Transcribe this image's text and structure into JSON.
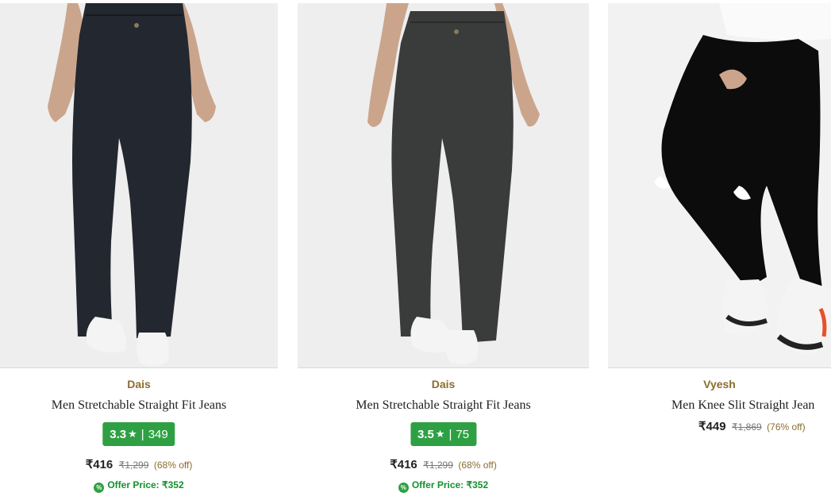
{
  "products": [
    {
      "brand": "Dais",
      "name": "Men Stretchable Straight Fit Jeans",
      "rating": "3.3",
      "star": "★",
      "separator": "|",
      "reviews": "349",
      "price": "₹416",
      "mrp": "₹1,299",
      "discount": "(68% off)",
      "offer": "Offer Price: ₹352",
      "offer_icon": "%",
      "jeans_color": "#23272f"
    },
    {
      "brand": "Dais",
      "name": "Men Stretchable Straight Fit Jeans",
      "rating": "3.5",
      "star": "★",
      "separator": "|",
      "reviews": "75",
      "price": "₹416",
      "mrp": "₹1,299",
      "discount": "(68% off)",
      "offer": "Offer Price: ₹352",
      "offer_icon": "%",
      "jeans_color": "#3a3c3b"
    },
    {
      "brand": "Vyesh",
      "name": "Men Knee Slit Straight Jean",
      "price": "₹449",
      "mrp": "₹1,869",
      "discount": "(76% off)",
      "jeans_color": "#0c0c0c"
    }
  ],
  "colors": {
    "brand_text": "#8b6d2e",
    "rating_badge": "#2ea043",
    "offer_text": "#14902c",
    "image_background": "#eeeeee"
  }
}
